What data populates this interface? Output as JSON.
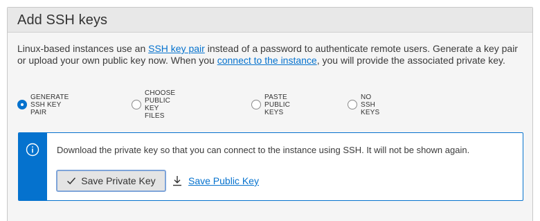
{
  "panel": {
    "title": "Add SSH keys"
  },
  "description": {
    "part1": "Linux-based instances use an ",
    "link1": "SSH key pair",
    "part2": " instead of a password to authenticate remote users. Generate a key pair or upload your own public key now. When you ",
    "link2": "connect to the instance",
    "part3": ", you will provide the associated private key."
  },
  "ssh_options": {
    "selected": "GENERATE SSH KEY PAIR",
    "items": [
      {
        "label": "GENERATE SSH KEY PAIR",
        "checked": true
      },
      {
        "label": "CHOOSE PUBLIC KEY FILES",
        "checked": false
      },
      {
        "label": "PASTE PUBLIC KEYS",
        "checked": false
      },
      {
        "label": "NO SSH KEYS",
        "checked": false
      }
    ]
  },
  "info_box": {
    "icon": "info-icon",
    "message": "Download the private key so that you can connect to the instance using SSH. It will not be shown again.",
    "save_private_label": "Save Private Key",
    "save_private_icon": "check-icon",
    "save_public_label": "Save Public Key",
    "save_public_icon": "download-icon"
  },
  "colors": {
    "accent": "#0572ce",
    "header_bg": "#e8e8e8",
    "panel_bg": "#f5f5f5"
  }
}
